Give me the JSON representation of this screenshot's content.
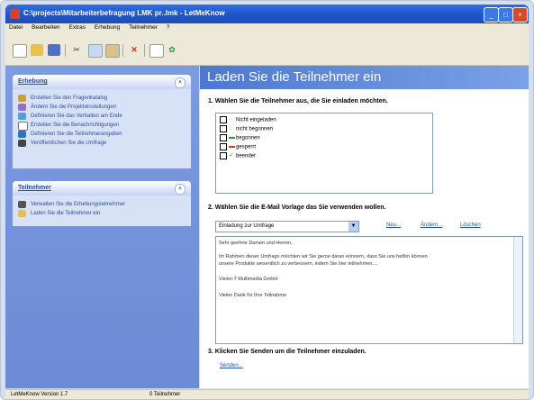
{
  "window": {
    "title": "C:\\projects\\Mitarbeiterbefragung LMK pr..lmk - LetMeKnow"
  },
  "menu": [
    "Datei",
    "Bearbeiten",
    "Extras",
    "Erhebung",
    "Teilnehmer",
    "?"
  ],
  "sidebar": {
    "erhebung": {
      "title": "Erhebung",
      "items": [
        "Erstellen Sie den Fragenkatalog",
        "Ändern Sie die Projekteinstellungen",
        "Definieren Sie das Verhalten am Ende",
        "Erstellen Sie die Benachrichtigungen",
        "Definieren Sie die Teilnehmerangaben",
        "Veröffentlichen Sie die Umfrage"
      ]
    },
    "teilnehmer": {
      "title": "Teilnehmer",
      "items": [
        "Verwalten Sie die Erhebungsteilnehmer",
        "Laden Sie die Teilnehmer ein"
      ]
    }
  },
  "main": {
    "header": "Laden Sie die Teilnehmer ein",
    "step1": "1. Wählen Sie die Teilnehmer aus, die Sie einladen möchten.",
    "legend": [
      {
        "label": "Nicht eingeladen",
        "color": "#e0c020",
        "symbol": "◌"
      },
      {
        "label": "nicht begonnen",
        "color": "#7090c0",
        "symbol": "◌"
      },
      {
        "label": "begonnen",
        "color": "#2a9a3a",
        "symbol": "▬"
      },
      {
        "label": "gesperrt",
        "color": "#d04020",
        "symbol": "▬"
      },
      {
        "label": "beendet",
        "color": "#20a030",
        "symbol": "✓"
      }
    ],
    "step2": "2. Wählen Sie die E-Mail Vorlage das Sie verwenden wollen.",
    "template": "Einladung zur Umfrage",
    "links": {
      "new": "Neu...",
      "edit": "Ändern...",
      "delete": "Löschen"
    },
    "email_lines": [
      "Sehr geehrte Damen und Herren,",
      "Im Rahmen dieser Umfrage möchten wir Sie gerne daran erinnern, dass Sie uns helfen können",
      "unsere Produkte wesentlich zu verbessern, indem Sie hier teilnehmen....",
      "Vision-7 Multimedia GmbH",
      "Vielen Dank für Ihre Teilnahme"
    ],
    "step3": "3. Klicken Sie Senden um die Teilnehmer einzuladen.",
    "send": "Senden..."
  },
  "status": {
    "version": "LetMeKnow Version 1.7",
    "count": "0 Teilnehmer"
  }
}
